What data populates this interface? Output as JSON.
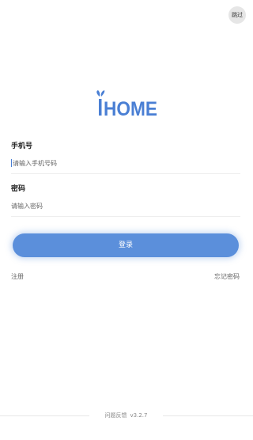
{
  "header": {
    "skip_label": "跳过"
  },
  "logo": {
    "text": "HOME",
    "color": "#4a7fd4"
  },
  "form": {
    "phone": {
      "label": "手机号",
      "placeholder": "请输入手机号码",
      "value": ""
    },
    "password": {
      "label": "密码",
      "placeholder": "请输入密码",
      "value": ""
    }
  },
  "login_button": {
    "label": "登录",
    "color": "#5b8fdb"
  },
  "links": {
    "register": "注册",
    "forgot_password": "忘记密码"
  },
  "footer": {
    "feedback": "问题反馈",
    "version": "v3.2.7"
  }
}
